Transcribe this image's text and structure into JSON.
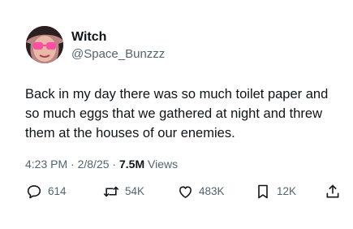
{
  "user": {
    "display_name": "Witch",
    "handle": "@Space_Bunzzz"
  },
  "tweet": {
    "text": "Back in my day there was so much toilet paper and so much eggs that we gathered at night and threw them at the houses of our enemies.",
    "time": "4:23 PM",
    "separator": "·",
    "date": "2/8/25",
    "views_count": "7.5M",
    "views_label": "Views"
  },
  "actions": {
    "replies": "614",
    "reposts": "54K",
    "likes": "483K",
    "bookmarks": "12K"
  },
  "colors": {
    "text": "#0f1419",
    "secondary": "#536471"
  },
  "icons": [
    "reply-icon",
    "repost-icon",
    "like-icon",
    "bookmark-icon",
    "share-icon"
  ]
}
